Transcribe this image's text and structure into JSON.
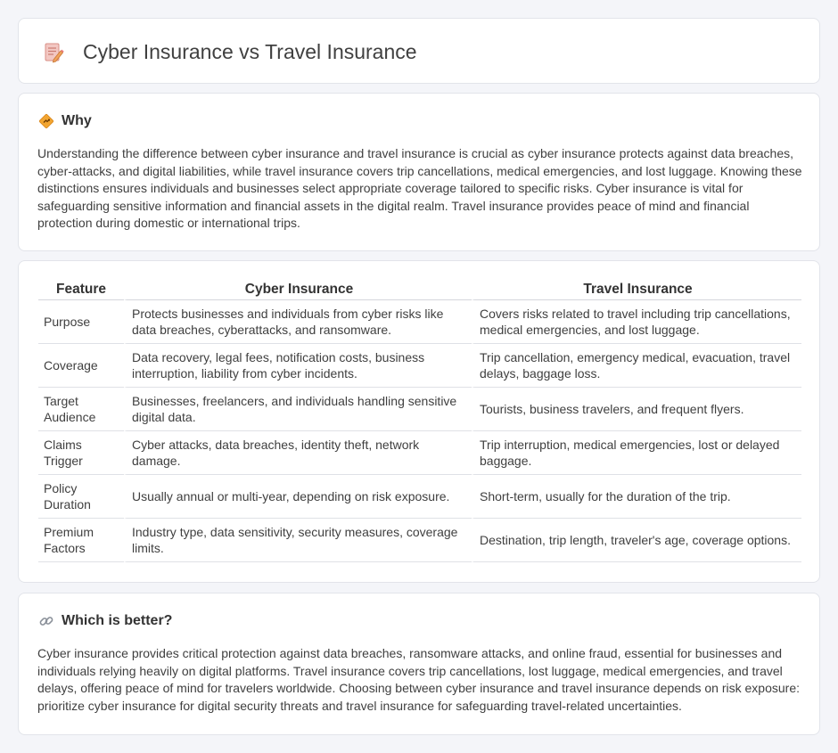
{
  "header": {
    "title": "Cyber Insurance vs Travel Insurance",
    "icon": "document-pencil-icon"
  },
  "why": {
    "icon": "diamond-sign-icon",
    "heading": "Why",
    "text": "Understanding the difference between cyber insurance and travel insurance is crucial as cyber insurance protects against data breaches, cyber-attacks, and digital liabilities, while travel insurance covers trip cancellations, medical emergencies, and lost luggage. Knowing these distinctions ensures individuals and businesses select appropriate coverage tailored to specific risks. Cyber insurance is vital for safeguarding sensitive information and financial assets in the digital realm. Travel insurance provides peace of mind and financial protection during domestic or international trips."
  },
  "comparison": {
    "headers": [
      "Feature",
      "Cyber Insurance",
      "Travel Insurance"
    ],
    "rows": [
      [
        "Purpose",
        "Protects businesses and individuals from cyber risks like data breaches, cyberattacks, and ransomware.",
        "Covers risks related to travel including trip cancellations, medical emergencies, and lost luggage."
      ],
      [
        "Coverage",
        "Data recovery, legal fees, notification costs, business interruption, liability from cyber incidents.",
        "Trip cancellation, emergency medical, evacuation, travel delays, baggage loss."
      ],
      [
        "Target Audience",
        "Businesses, freelancers, and individuals handling sensitive digital data.",
        "Tourists, business travelers, and frequent flyers."
      ],
      [
        "Claims Trigger",
        "Cyber attacks, data breaches, identity theft, network damage.",
        "Trip interruption, medical emergencies, lost or delayed baggage."
      ],
      [
        "Policy Duration",
        "Usually annual or multi-year, depending on risk exposure.",
        "Short-term, usually for the duration of the trip."
      ],
      [
        "Premium Factors",
        "Industry type, data sensitivity, security measures, coverage limits.",
        "Destination, trip length, traveler's age, coverage options."
      ]
    ]
  },
  "better": {
    "icon": "link-icon",
    "heading": "Which is better?",
    "text": "Cyber insurance provides critical protection against data breaches, ransomware attacks, and online fraud, essential for businesses and individuals relying heavily on digital platforms. Travel insurance covers trip cancellations, lost luggage, medical emergencies, and travel delays, offering peace of mind for travelers worldwide. Choosing between cyber insurance and travel insurance depends on risk exposure: prioritize cyber insurance for digital security threats and travel insurance for safeguarding travel-related uncertainties."
  }
}
